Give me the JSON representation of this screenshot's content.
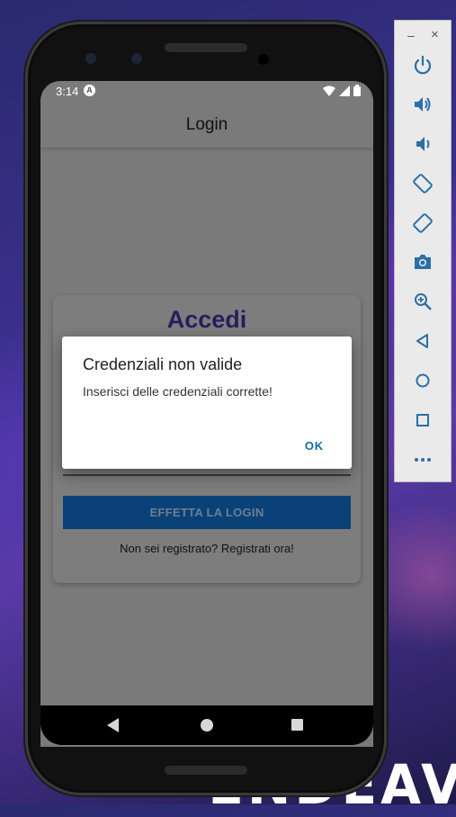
{
  "device": {
    "status_bar": {
      "time": "3:14",
      "badge": "A"
    },
    "app_bar": {
      "title": "Login"
    },
    "card": {
      "title": "Accedi",
      "login_button": "EFFETTA LA LOGIN",
      "register_link": "Non sei registrato? Registrati ora!"
    },
    "dialog": {
      "title": "Credenziali non valide",
      "message": "Inserisci delle credenziali corrette!",
      "ok_label": "OK"
    }
  },
  "emulator_panel": {
    "minimize_label": "–",
    "close_label": "×",
    "tools": [
      "power-icon",
      "volume-up-icon",
      "volume-down-icon",
      "rotate-left-icon",
      "rotate-right-icon",
      "camera-icon",
      "zoom-icon",
      "back-icon",
      "home-icon",
      "overview-icon",
      "more-icon"
    ]
  },
  "wallpaper": {
    "text": "ENDEAV"
  },
  "colors": {
    "accent": "#0f6fa8",
    "button": "#0a4177",
    "card_title": "#281d5e",
    "panel_icon": "#2a6fa8"
  }
}
